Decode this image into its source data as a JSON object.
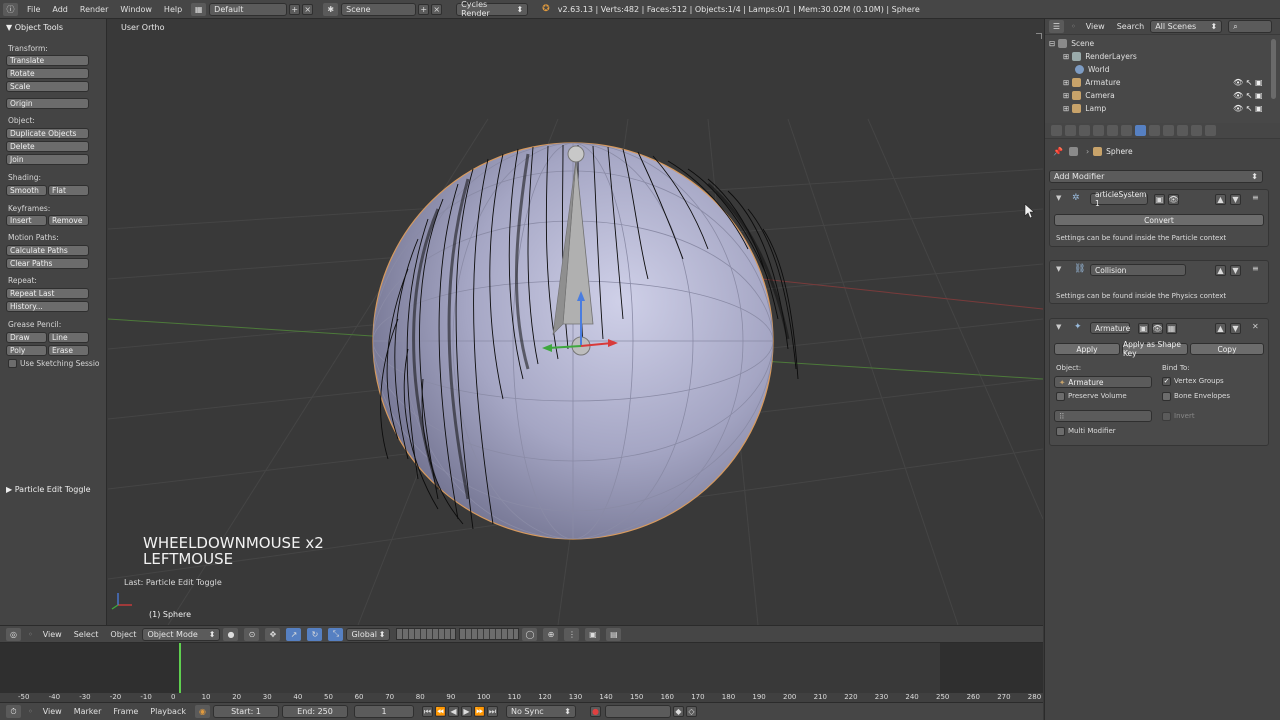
{
  "topbar": {
    "menus": [
      "File",
      "Add",
      "Render",
      "Window",
      "Help"
    ],
    "layout": "Default",
    "scene": "Scene",
    "engine": "Cycles Render",
    "stats": "v2.63.13 | Verts:482 | Faces:512 | Objects:1/4 | Lamps:0/1 | Mem:30.02M (0.10M) | Sphere"
  },
  "toolshelf": {
    "title": "Object Tools",
    "transform_label": "Transform:",
    "translate": "Translate",
    "rotate": "Rotate",
    "scale": "Scale",
    "origin": "Origin",
    "object_label": "Object:",
    "duplicate": "Duplicate Objects",
    "delete": "Delete",
    "join": "Join",
    "shading_label": "Shading:",
    "smooth": "Smooth",
    "flat": "Flat",
    "keyframes_label": "Keyframes:",
    "insert": "Insert",
    "remove": "Remove",
    "motion_label": "Motion Paths:",
    "calc_paths": "Calculate Paths",
    "clear_paths": "Clear Paths",
    "repeat_label": "Repeat:",
    "repeat_last": "Repeat Last",
    "history": "History...",
    "grease_label": "Grease Pencil:",
    "draw": "Draw",
    "line": "Line",
    "poly": "Poly",
    "erase": "Erase",
    "sketching": "Use Sketching Sessio",
    "last_op_panel": "Particle Edit Toggle"
  },
  "viewport": {
    "view_name": "User Ortho",
    "key_line1": "WHEELDOWNMOUSE x2",
    "key_line2": "LEFTMOUSE",
    "last_op": "Last: Particle Edit Toggle",
    "object_name": "(1) Sphere"
  },
  "vp_header": {
    "view": "View",
    "select": "Select",
    "object": "Object",
    "mode": "Object Mode",
    "orientation": "Global"
  },
  "timeline": {
    "ticks": [
      "-50",
      "-40",
      "-30",
      "-20",
      "-10",
      "0",
      "10",
      "20",
      "30",
      "40",
      "50",
      "60",
      "70",
      "80",
      "90",
      "100",
      "110",
      "120",
      "130",
      "140",
      "150",
      "160",
      "170",
      "180",
      "190",
      "200",
      "210",
      "220",
      "230",
      "240",
      "250",
      "260",
      "270",
      "280"
    ],
    "current_frame": 1,
    "view": "View",
    "marker": "Marker",
    "frame": "Frame",
    "playback": "Playback",
    "start": "Start: 1",
    "end": "End: 250",
    "current": "1",
    "sync": "No Sync"
  },
  "outliner": {
    "view": "View",
    "search": "Search",
    "filter": "All Scenes",
    "rows": [
      "Scene",
      "RenderLayers",
      "World",
      "Armature",
      "Camera",
      "Lamp"
    ]
  },
  "properties": {
    "object": "Sphere",
    "add_modifier": "Add Modifier",
    "mod1_name": "articleSystem 1",
    "convert": "Convert",
    "mod1_note": "Settings can be found inside the Particle context",
    "mod2_name": "Collision",
    "mod2_note": "Settings can be found inside the Physics context",
    "mod3_name": "Armature",
    "apply": "Apply",
    "apply_shape": "Apply as Shape Key",
    "copy": "Copy",
    "object_label": "Object:",
    "object_value": "Armature",
    "bind_to": "Bind To:",
    "vertex_groups": "Vertex Groups",
    "preserve_volume": "Preserve Volume",
    "bone_envelopes": "Bone Envelopes",
    "invert": "Invert",
    "multi_modifier": "Multi Modifier"
  }
}
